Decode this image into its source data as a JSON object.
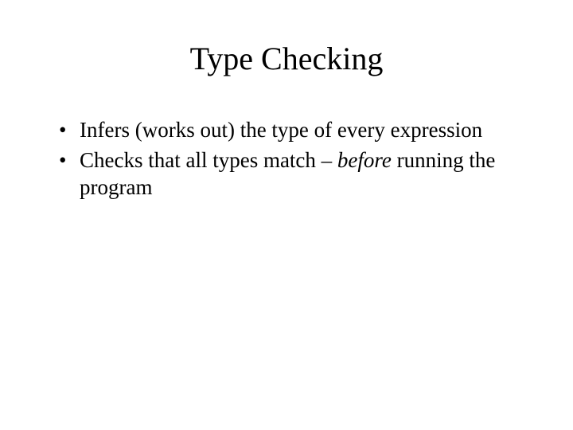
{
  "slide": {
    "title": "Type Checking",
    "bullets": [
      {
        "prefix": "Infers (works out) the type of every expression",
        "italic": "",
        "suffix": ""
      },
      {
        "prefix": "Checks that all types match – ",
        "italic": "before",
        "suffix": " running the program"
      }
    ]
  }
}
